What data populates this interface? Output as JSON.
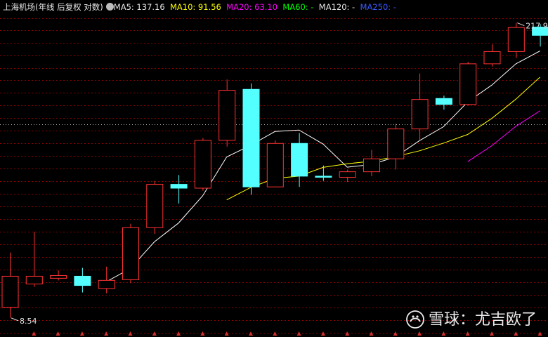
{
  "legend": {
    "title": "上海机场(年线 后复权 对数)",
    "ma5": "MA5: 137.16",
    "ma10": "MA10: 91.56",
    "ma20": "MA20: 63.10",
    "ma60": "MA60: -",
    "ma120": "MA120: -",
    "ma250": "MA250: -"
  },
  "colors": {
    "up": "#ff3232",
    "down": "#54ffff",
    "grid": "#8b0000",
    "ma5": "#ffffff",
    "ma10": "#ffff00",
    "ma20": "#ff00ff",
    "ma60": "#00ff00",
    "ma250": "#0000ff"
  },
  "labels": {
    "max_label": "217.9",
    "min_label": "8.54"
  },
  "watermark": {
    "text": "雪球：尤吉欧了"
  },
  "chart_data": {
    "type": "candlestick",
    "y_scale": "log",
    "ylim": [
      7.6,
      240
    ],
    "candles": [
      {
        "open": 9.6,
        "close": 13.5,
        "high": 17.5,
        "low": 8.54
      },
      {
        "open": 12.4,
        "close": 13.5,
        "high": 22.0,
        "low": 12.0
      },
      {
        "open": 13.2,
        "close": 13.6,
        "high": 14.4,
        "low": 12.9
      },
      {
        "open": 13.5,
        "close": 12.2,
        "high": 14.8,
        "low": 11.3
      },
      {
        "open": 11.8,
        "close": 12.9,
        "high": 15.0,
        "low": 11.2
      },
      {
        "open": 13.0,
        "close": 23.0,
        "high": 24.0,
        "low": 12.5
      },
      {
        "open": 23.0,
        "close": 37.0,
        "high": 38.5,
        "low": 21.5
      },
      {
        "open": 37.0,
        "close": 35.5,
        "high": 41.0,
        "low": 30.0
      },
      {
        "open": 35.5,
        "close": 60.0,
        "high": 61.5,
        "low": 34.5
      },
      {
        "open": 60.0,
        "close": 104.0,
        "high": 117.0,
        "low": 56.0
      },
      {
        "open": 105.0,
        "close": 36.0,
        "high": 112.0,
        "low": 33.0
      },
      {
        "open": 36.0,
        "close": 58.0,
        "high": 60.0,
        "low": 36.0
      },
      {
        "open": 58.0,
        "close": 40.5,
        "high": 65.0,
        "low": 36.0
      },
      {
        "open": 40.5,
        "close": 40.0,
        "high": 45.5,
        "low": 38.5
      },
      {
        "open": 40.0,
        "close": 42.5,
        "high": 43.5,
        "low": 38.0
      },
      {
        "open": 42.5,
        "close": 49.0,
        "high": 54.0,
        "low": 40.5
      },
      {
        "open": 49.0,
        "close": 68.0,
        "high": 72.0,
        "low": 43.5
      },
      {
        "open": 68.0,
        "close": 94.0,
        "high": 125.0,
        "low": 60.0
      },
      {
        "open": 95.0,
        "close": 89.0,
        "high": 98.0,
        "low": 84.0
      },
      {
        "open": 89.0,
        "close": 139.0,
        "high": 142.0,
        "low": 88.0
      },
      {
        "open": 139.0,
        "close": 159.0,
        "high": 172.0,
        "low": 135.0
      },
      {
        "open": 159.0,
        "close": 207.0,
        "high": 217.9,
        "low": 148.0
      },
      {
        "open": 208.0,
        "close": 190.0,
        "high": 215.0,
        "low": 168.0
      }
    ],
    "series": [
      {
        "name": "MA5",
        "color": "#ffffff",
        "values": [
          null,
          null,
          null,
          null,
          12.7,
          14.7,
          19.7,
          24.2,
          32.6,
          50.0,
          56.9,
          66.1,
          67.2,
          57.6,
          44.7,
          46.0,
          50.0,
          59.8,
          69.7,
          91.5,
          110.0,
          139.0,
          160.0
        ]
      },
      {
        "name": "MA10",
        "color": "#ffff00",
        "values": [
          null,
          null,
          null,
          null,
          null,
          null,
          null,
          null,
          null,
          31.2,
          35.8,
          39.5,
          40.5,
          44.6,
          46.4,
          47.7,
          50.2,
          53.5,
          58.2,
          64.0,
          76.3,
          94.3,
          120.0
        ]
      },
      {
        "name": "MA20",
        "color": "#ff00ff",
        "values": [
          null,
          null,
          null,
          null,
          null,
          null,
          null,
          null,
          null,
          null,
          null,
          null,
          null,
          null,
          null,
          null,
          null,
          null,
          null,
          47.5,
          56.6,
          70.0,
          83.0
        ]
      }
    ]
  }
}
